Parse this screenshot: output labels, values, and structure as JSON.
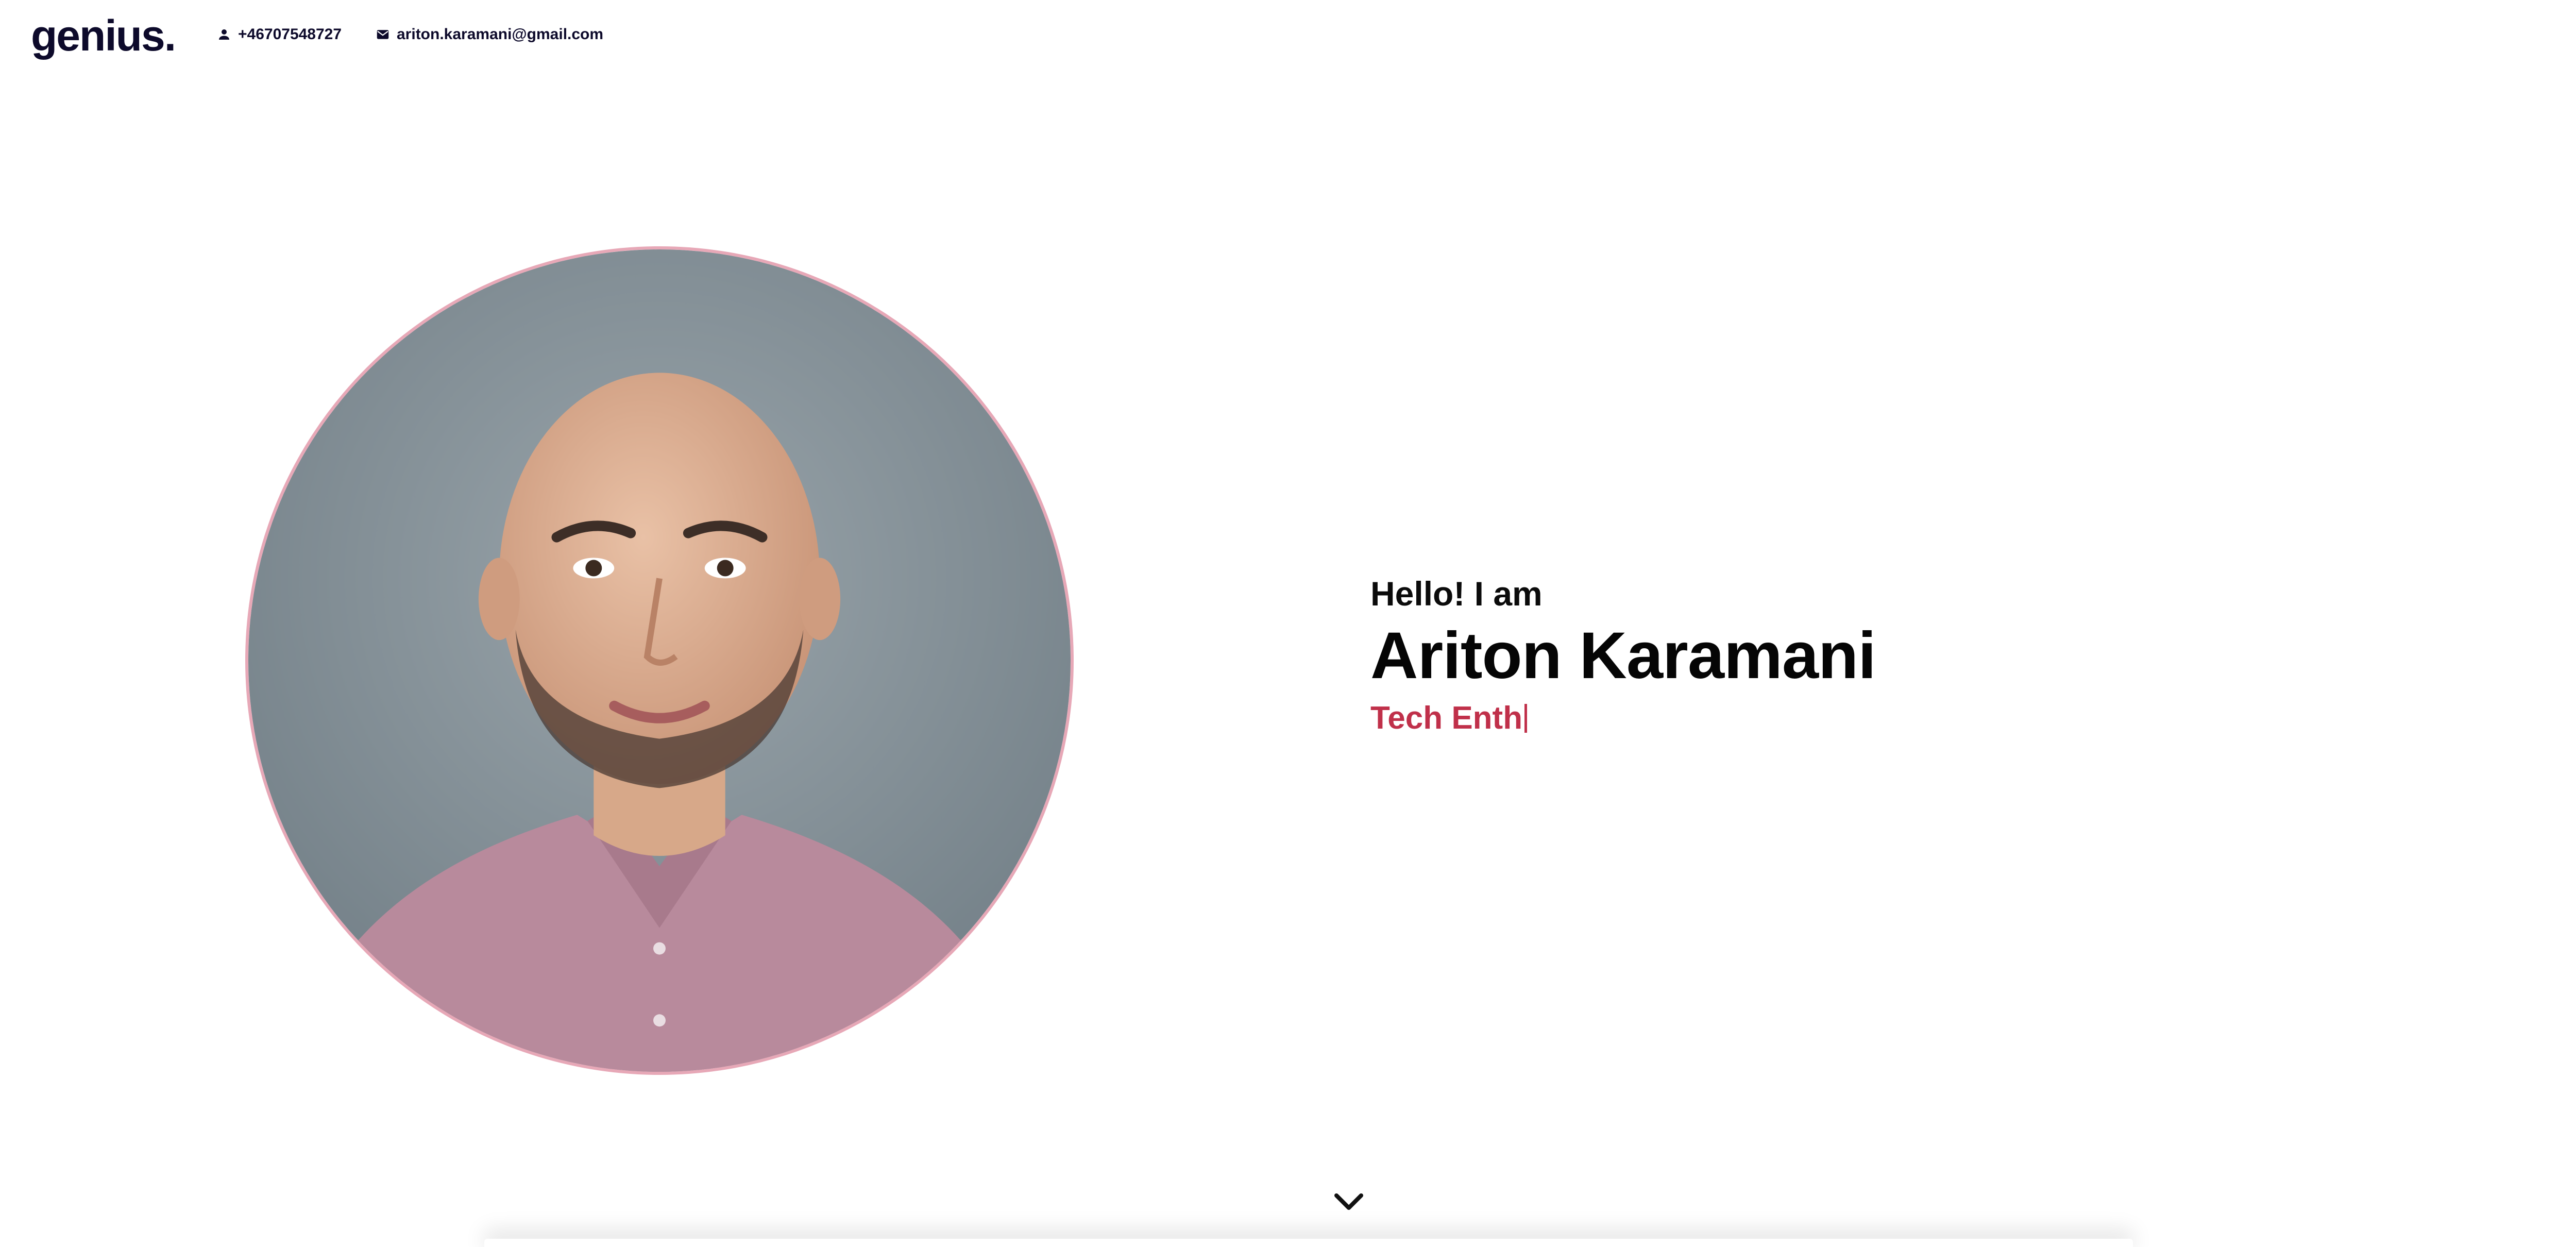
{
  "header": {
    "logo": "genius.",
    "phone": {
      "icon": "person-icon",
      "text": "+46707548727"
    },
    "email": {
      "icon": "mail-icon",
      "text": "ariton.karamani@gmail.com"
    },
    "menu_icon": "hamburger-menu-icon"
  },
  "hero": {
    "greeting": "Hello! I am",
    "name": "Ariton Karamani",
    "role_typed": "Tech Enth",
    "portrait_icon": "profile-photo",
    "accent_color": "#c0304a",
    "portrait_border_color": "#e7a8b7"
  },
  "scroll_down": {
    "icon": "chevron-down-icon"
  }
}
